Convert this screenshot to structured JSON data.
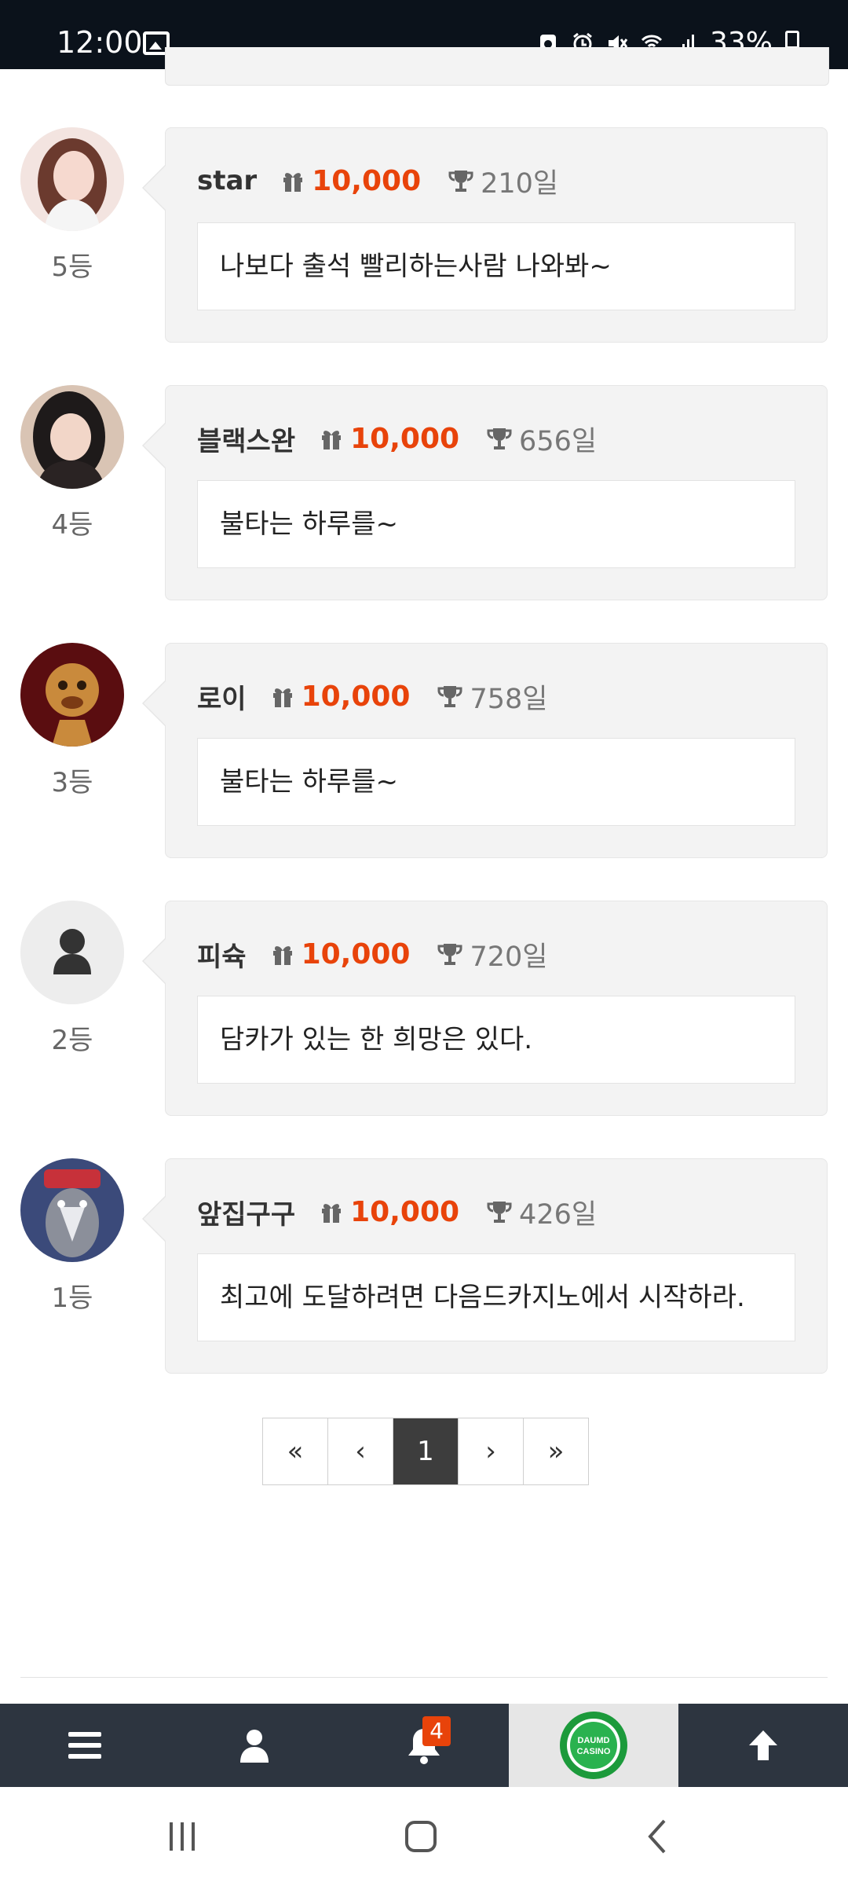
{
  "status_bar": {
    "time": "12:00",
    "battery": "33%",
    "icons": [
      "gallery-icon",
      "battery-saver-icon",
      "alarm-icon",
      "mute-icon",
      "wifi-icon",
      "signal-icon",
      "battery-icon"
    ]
  },
  "entries": [
    {
      "rank": "5등",
      "nickname": "star",
      "points": "10,000",
      "days": "210일",
      "message": "나보다 출석 빨리하는사람 나와봐~",
      "avatar": "photo"
    },
    {
      "rank": "4등",
      "nickname": "블랙스완",
      "points": "10,000",
      "days": "656일",
      "message": "불타는 하루를~",
      "avatar": "photo"
    },
    {
      "rank": "3등",
      "nickname": "로이",
      "points": "10,000",
      "days": "758일",
      "message": "불타는 하루를~",
      "avatar": "cartoon"
    },
    {
      "rank": "2등",
      "nickname": "피슉",
      "points": "10,000",
      "days": "720일",
      "message": "담카가 있는 한 희망은 있다.",
      "avatar": "default-user"
    },
    {
      "rank": "1등",
      "nickname": "앞집구구",
      "points": "10,000",
      "days": "426일",
      "message": "최고에 도달하려면 다음드카지노에서 시작하라.",
      "avatar": "cartoon-bird"
    }
  ],
  "pagination": {
    "first": "«",
    "prev": "‹",
    "current": "1",
    "next": "›",
    "last": "»"
  },
  "app_nav": {
    "notification_count": "4",
    "logo_text_line1": "DAUMD",
    "logo_text_line2": "CASINO",
    "items": [
      "menu-icon",
      "user-icon",
      "bell-icon",
      "logo",
      "arrow-up-icon"
    ]
  },
  "colors": {
    "accent": "#e8430a",
    "nav_bg": "#2d3540",
    "card_bg": "#f3f3f3",
    "status_bg": "#0b121b"
  }
}
